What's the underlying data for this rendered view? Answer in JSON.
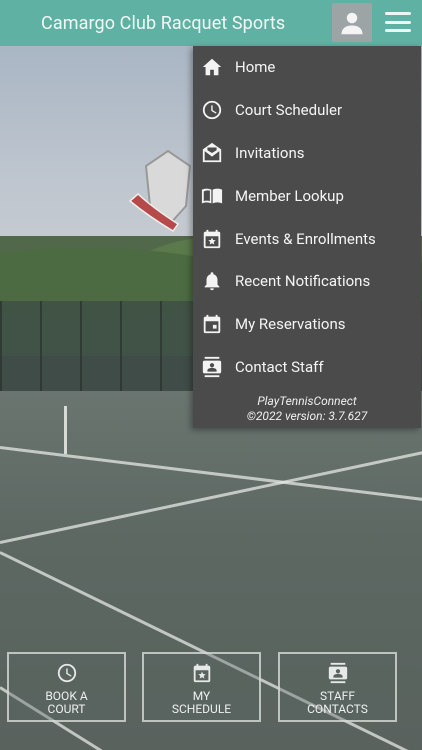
{
  "header": {
    "title": "Camargo Club Racquet Sports",
    "profile_icon": "person-icon",
    "menu_icon": "hamburger-menu-icon"
  },
  "menu": {
    "items": [
      {
        "label": "Home",
        "icon": "home-icon"
      },
      {
        "label": "Court Scheduler",
        "icon": "clock-icon"
      },
      {
        "label": "Invitations",
        "icon": "envelope-icon"
      },
      {
        "label": "Member Lookup",
        "icon": "open-book-icon"
      },
      {
        "label": "Events & Enrollments",
        "icon": "calendar-star-icon"
      },
      {
        "label": "Recent Notifications",
        "icon": "bell-icon"
      },
      {
        "label": "My Reservations",
        "icon": "calendar-icon"
      },
      {
        "label": "Contact Staff",
        "icon": "contact-card-icon"
      }
    ],
    "footer_app": "PlayTennisConnect",
    "footer_version": "©2022 version: 3.7.627"
  },
  "tiles": [
    {
      "line1": "BOOK A",
      "line2": "COURT",
      "icon": "clock-icon"
    },
    {
      "line1": "MY",
      "line2": "SCHEDULE",
      "icon": "calendar-star-icon"
    },
    {
      "line1": "STAFF",
      "line2": "CONTACTS",
      "icon": "contact-card-icon"
    }
  ],
  "colors": {
    "header_bg": "#5fb2a3",
    "menu_bg": "#4b4b4b"
  }
}
